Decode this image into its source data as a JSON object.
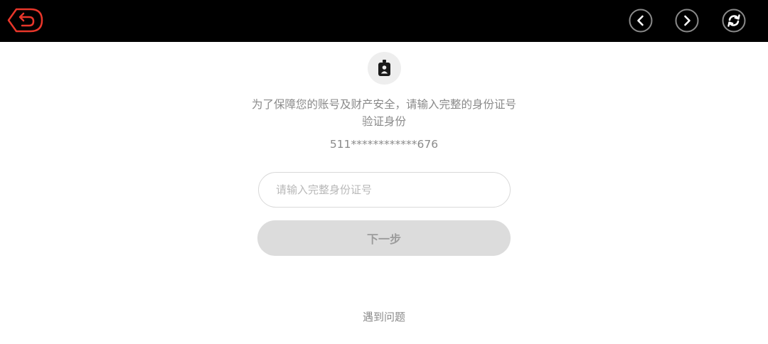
{
  "topbar": {
    "back_icon": "back-arrow-icon",
    "prev_icon": "chevron-left-icon",
    "next_icon": "chevron-right-icon",
    "refresh_icon": "refresh-icon",
    "accent_color": "#e8362a",
    "background_color": "#000000"
  },
  "main": {
    "badge_icon": "id-card-icon",
    "message": "为了保障您的账号及财产安全，请输入完整的身份证号验证身份",
    "masked_id": "511************676",
    "id_input": {
      "value": "",
      "placeholder": "请输入完整身份证号"
    },
    "next_button_label": "下一步",
    "problem_link": "遇到问题"
  }
}
